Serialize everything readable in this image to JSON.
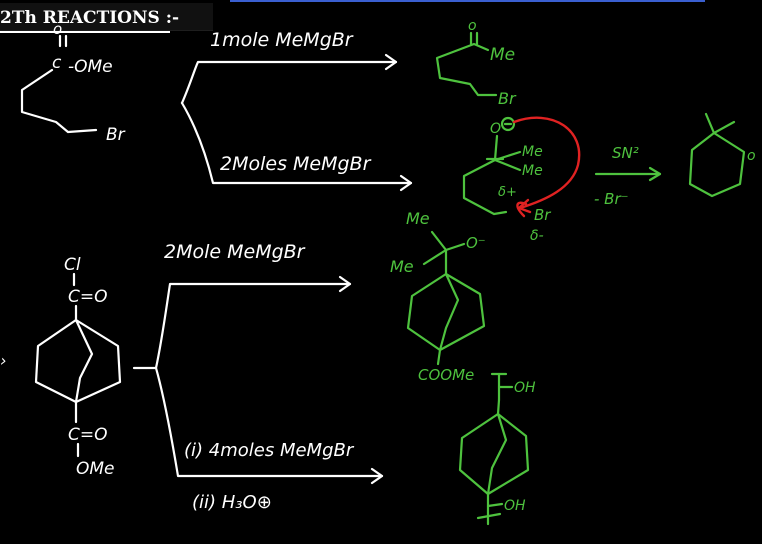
{
  "header": {
    "title": "2Th REACTIONS :-"
  },
  "colors": {
    "white": "#ffffff",
    "green": "#4ec23e",
    "red": "#e02222",
    "background": "#000000",
    "accent": "#3a5fd0"
  },
  "reaction1": {
    "substituent_ome": "-OMe",
    "substituent_br": "Br",
    "reagent_top": "1mole MeMgBr",
    "reagent_bottom": "2Moles MeMgBr",
    "product1_me": "Me",
    "product1_br": "Br",
    "intermediate_o": "O",
    "intermediate_me1": "Me",
    "intermediate_me2": "Me",
    "intermediate_delta_plus": "δ+",
    "intermediate_br": "Br",
    "intermediate_delta_minus": "δ-",
    "step_label_top": "SN²",
    "step_label_bottom": "- Br⁻"
  },
  "reaction2": {
    "carbonyl_top": "C=O",
    "carbonyl_top_sub": "Cl",
    "carbonyl_bottom": "C=O",
    "carbonyl_bottom_sub": "OMe",
    "reagent_top": "2Mole MeMgBr",
    "reagent_bottom_1": "(i) 4moles MeMgBr",
    "reagent_bottom_2": "(ii) H₃O⊕",
    "product_top_me1": "Me",
    "product_top_me2": "Me",
    "product_top_o": "O⁻",
    "product_top_coome": "COOMe",
    "product_bottom_oh1": "OH",
    "product_bottom_oh2": "OH"
  }
}
